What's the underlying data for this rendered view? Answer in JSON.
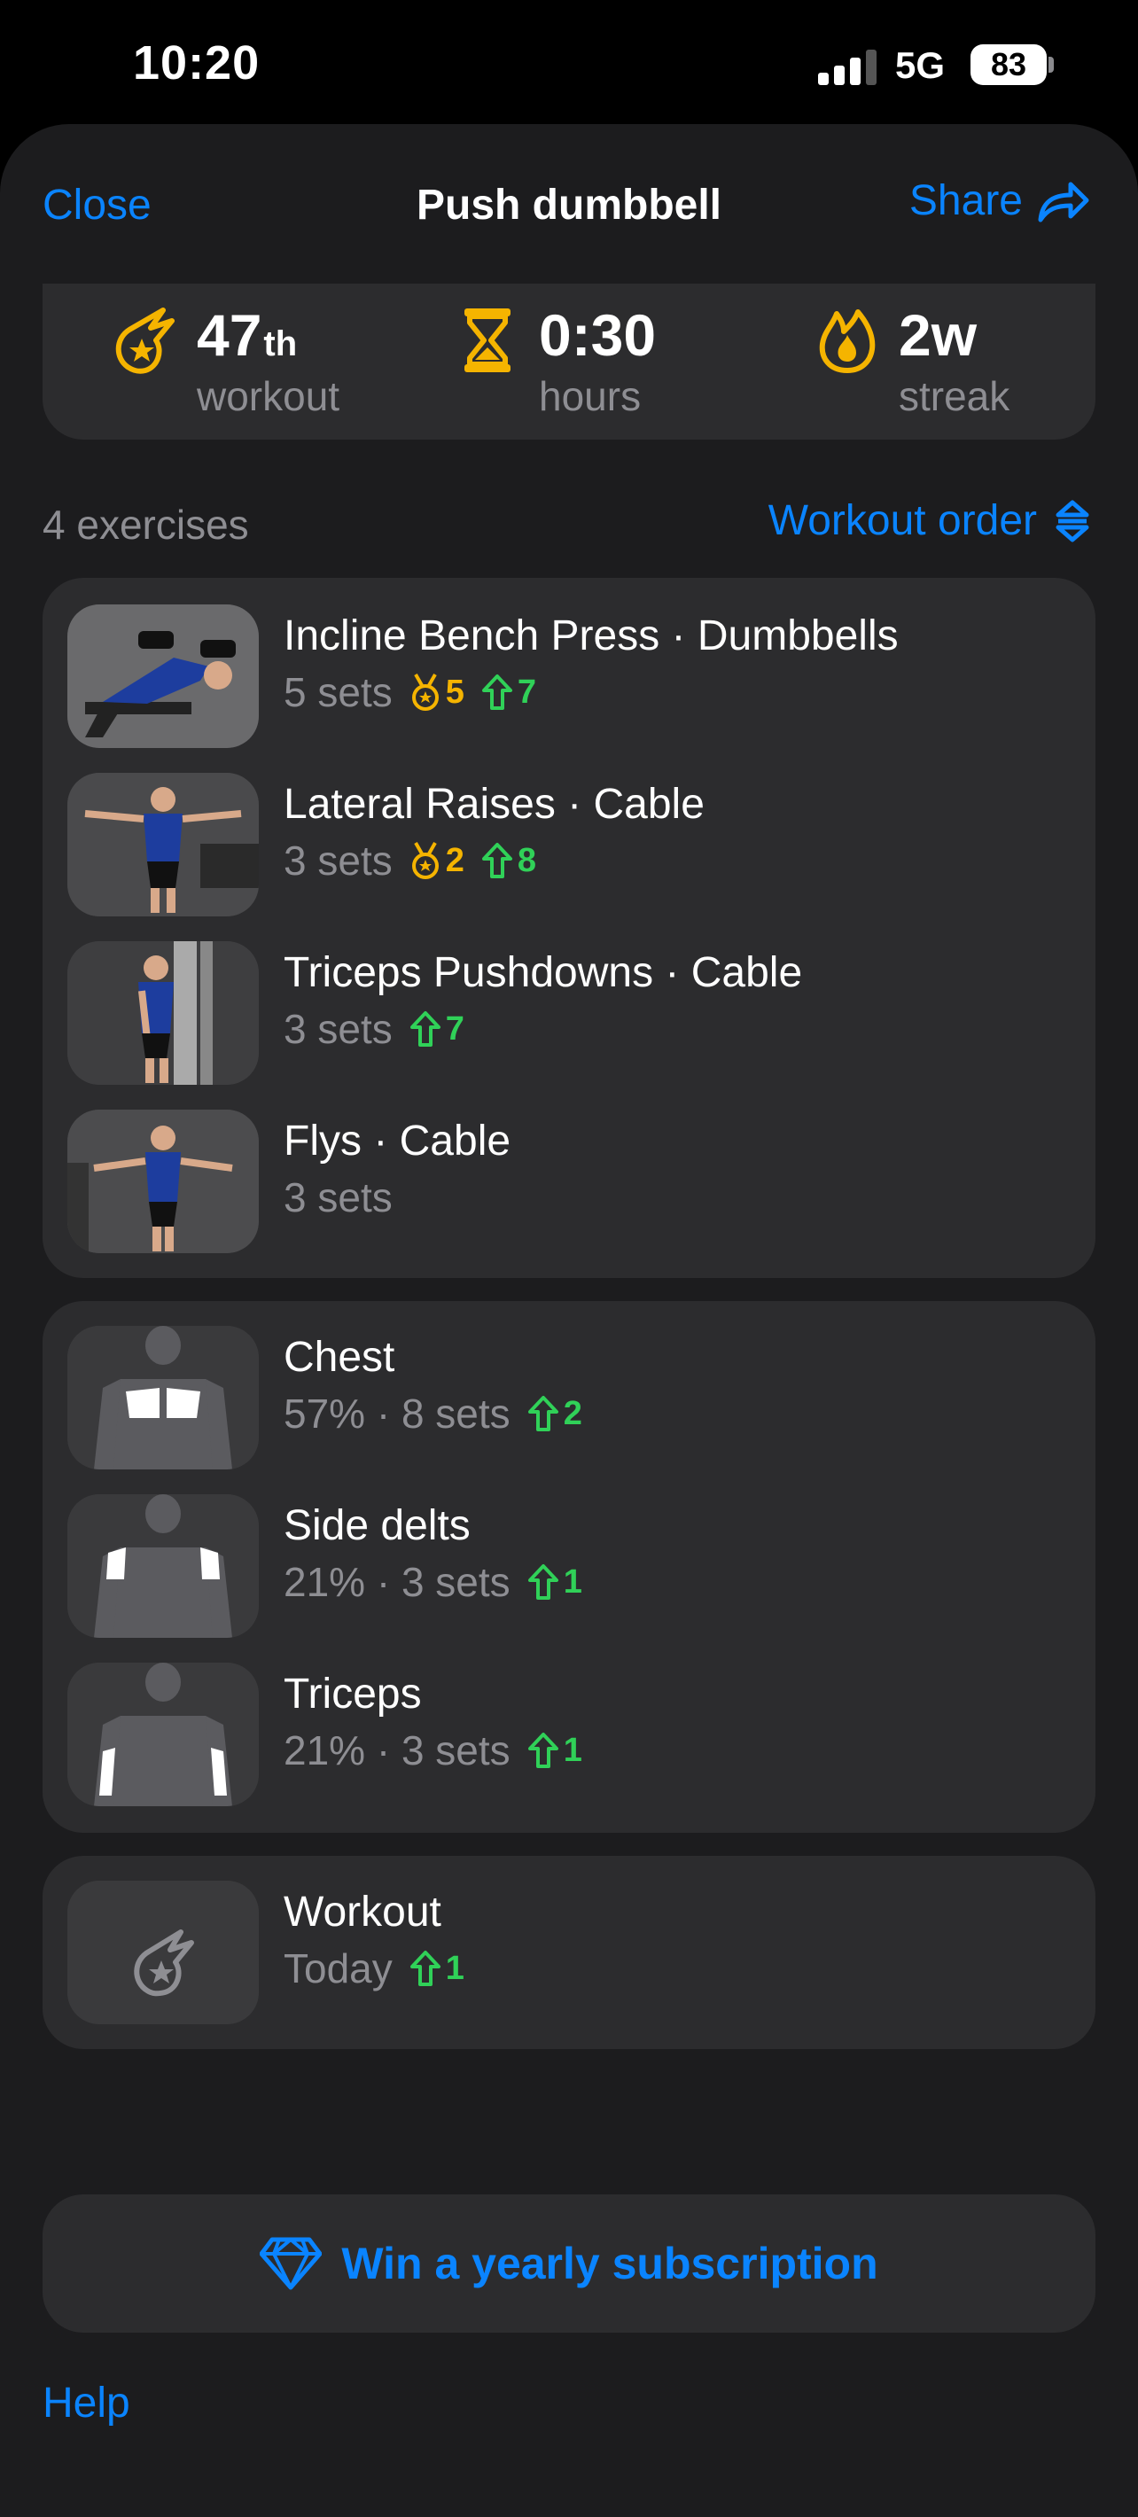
{
  "status_bar": {
    "time": "10:20",
    "network": "5G",
    "battery": "83"
  },
  "nav": {
    "close_label": "Close",
    "title": "Push dumbbell",
    "share_label": "Share"
  },
  "stats": [
    {
      "value": "47",
      "suffix": "th",
      "label": "workout",
      "icon": "meteor-star-icon"
    },
    {
      "value": "0:30",
      "suffix": "",
      "label": "hours",
      "icon": "hourglass-icon"
    },
    {
      "value": "2w",
      "suffix": "",
      "label": "streak",
      "icon": "flame-icon"
    }
  ],
  "exercises_header": {
    "count_label": "4 exercises",
    "order_label": "Workout order"
  },
  "exercises": [
    {
      "name": "Incline Bench Press · Dumbbells",
      "sets": "5 sets",
      "medal": "5",
      "up": "7"
    },
    {
      "name": "Lateral Raises · Cable",
      "sets": "3 sets",
      "medal": "2",
      "up": "8"
    },
    {
      "name": "Triceps Pushdowns · Cable",
      "sets": "3 sets",
      "up": "7"
    },
    {
      "name": "Flys · Cable",
      "sets": "3 sets"
    }
  ],
  "muscles": [
    {
      "name": "Chest",
      "detail": "57% · 8 sets",
      "up": "2"
    },
    {
      "name": "Side delts",
      "detail": "21% · 3 sets",
      "up": "1"
    },
    {
      "name": "Triceps",
      "detail": "21% · 3 sets",
      "up": "1"
    }
  ],
  "workout_card": {
    "name": "Workout",
    "detail": "Today",
    "up": "1"
  },
  "promo_label": "Win a yearly subscription",
  "help_label": "Help",
  "colors": {
    "accent": "#0a84ff",
    "gold": "#f5b400",
    "green": "#30d158",
    "card": "#2c2c2e",
    "sheet": "#1c1c1e"
  }
}
